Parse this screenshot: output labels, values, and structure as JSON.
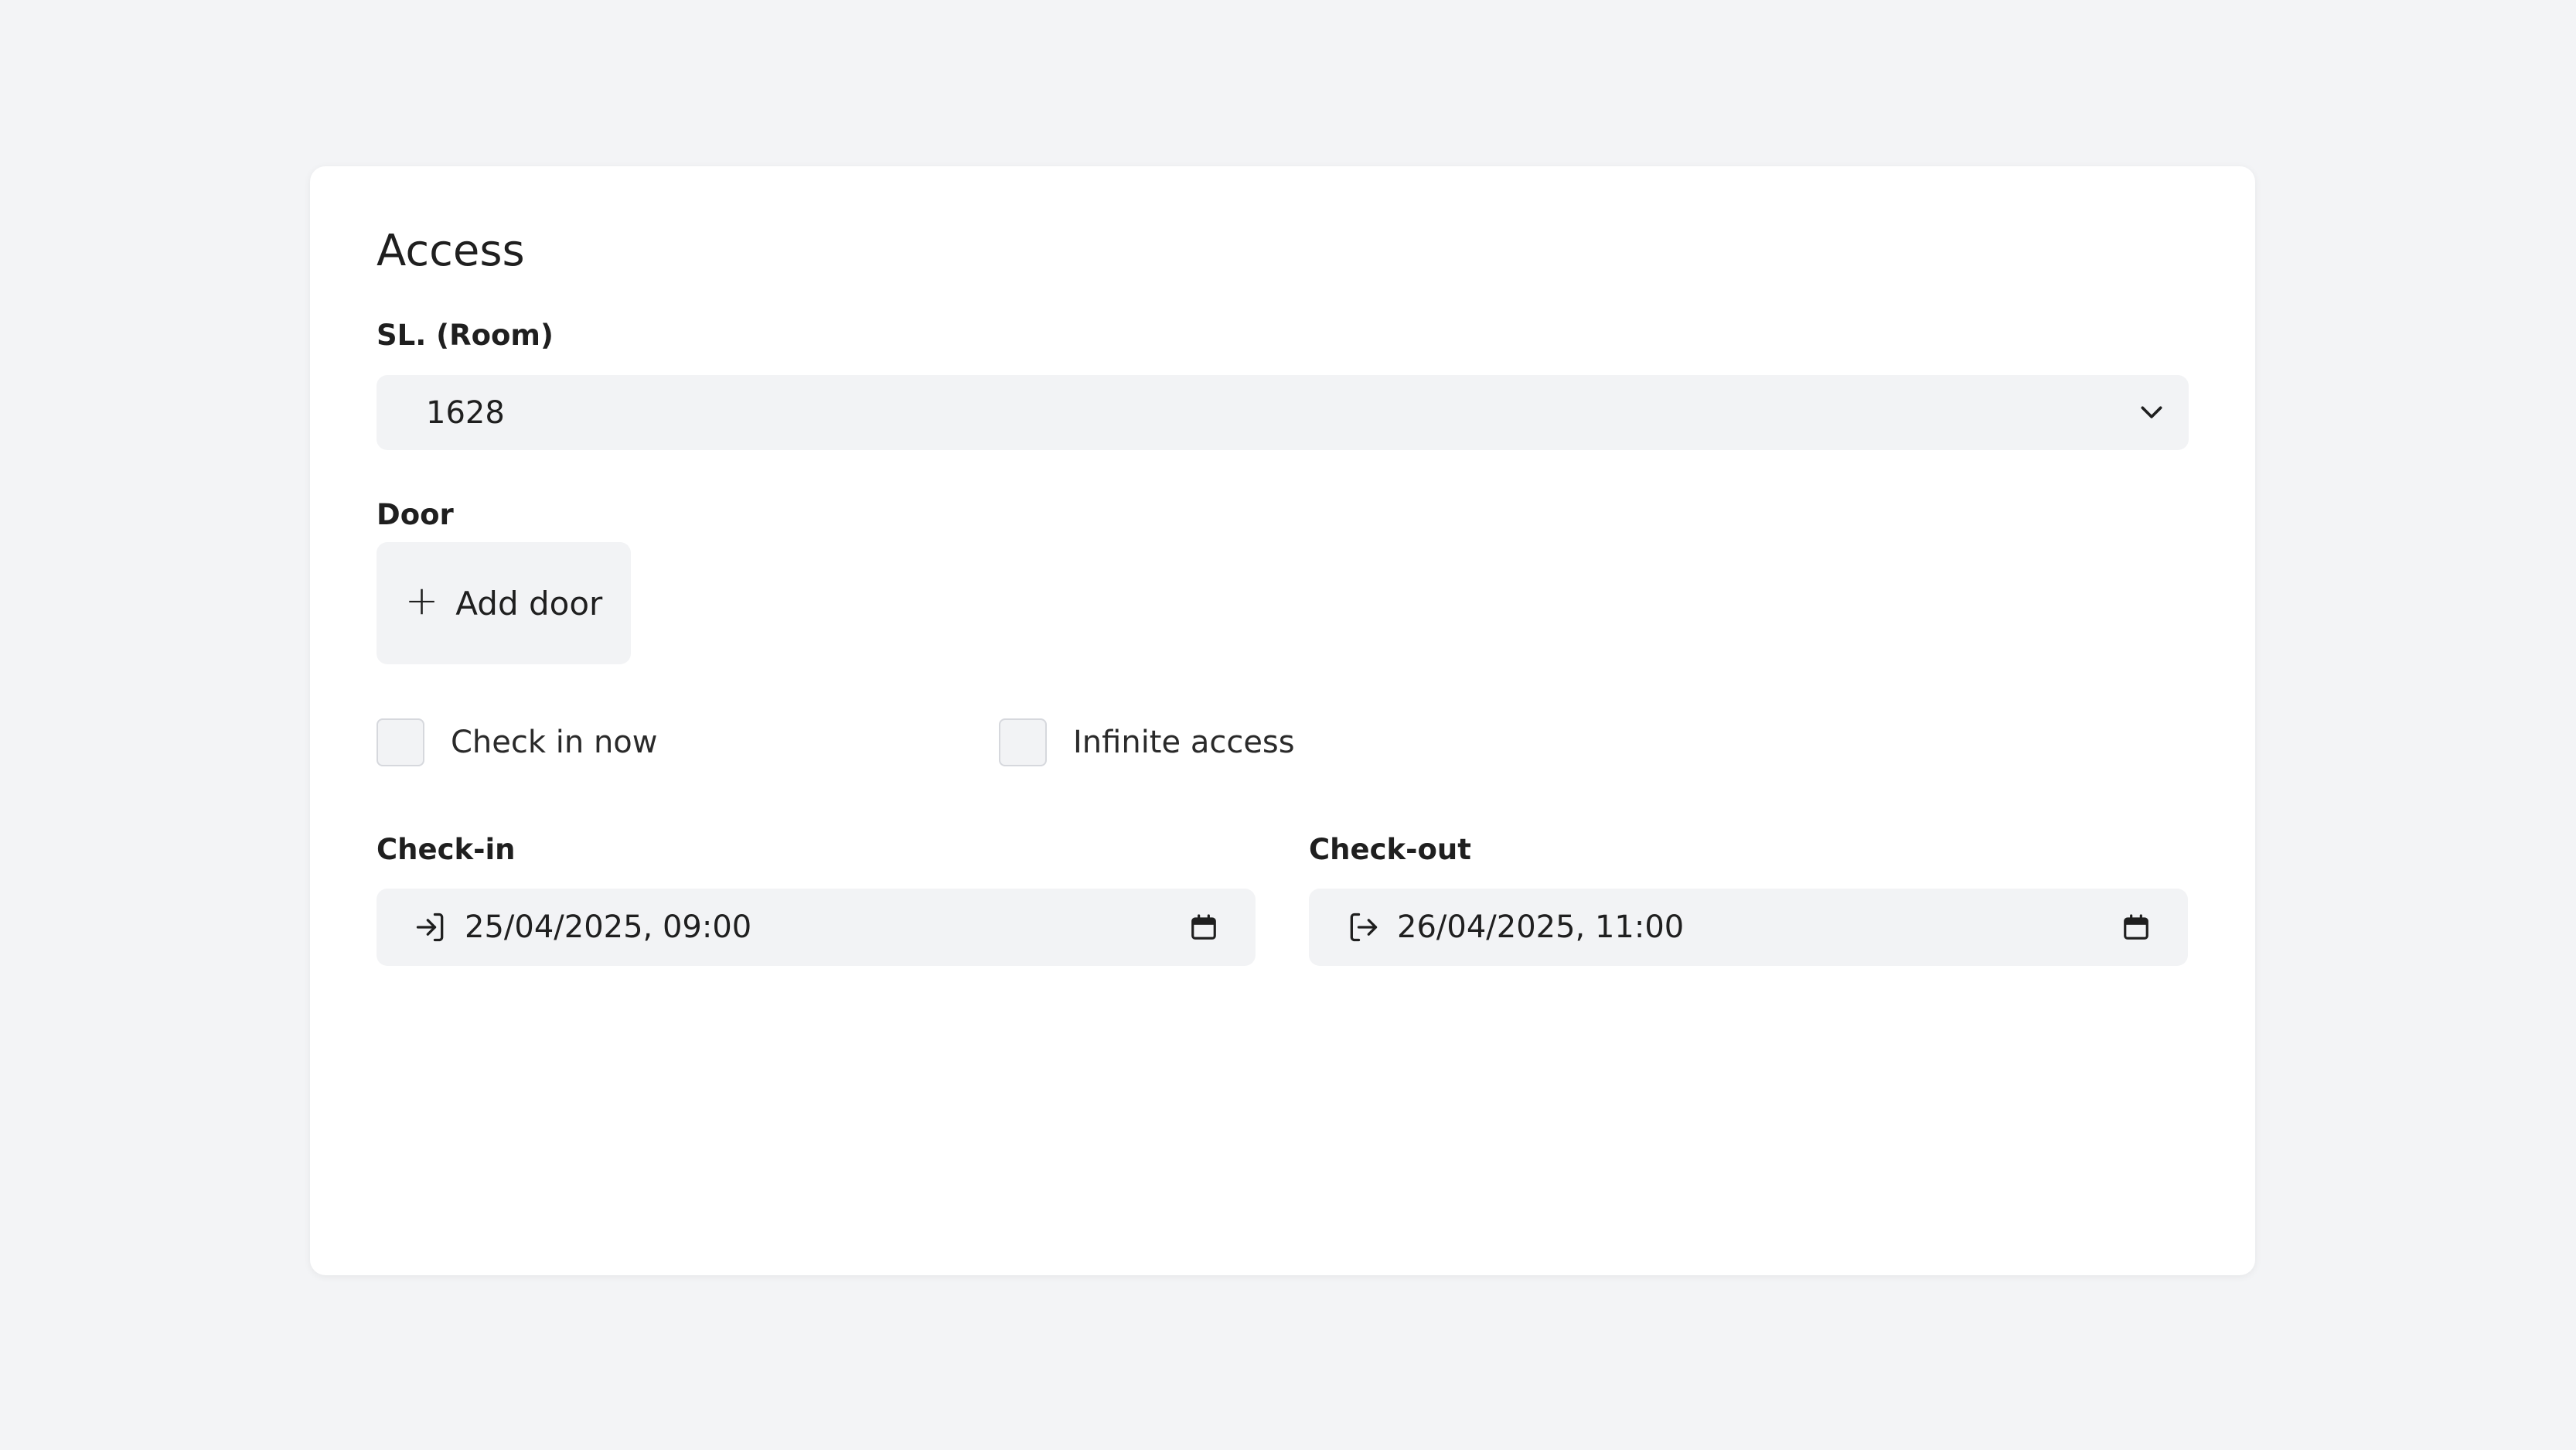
{
  "panel": {
    "title": "Access"
  },
  "room": {
    "label": "SL. (Room)",
    "selected": "1628",
    "icon": "chevron-down-icon"
  },
  "door": {
    "label": "Door",
    "add_button_label": "Add door",
    "add_icon": "plus-icon"
  },
  "options": {
    "check_in_now": {
      "label": "Check in now",
      "checked": false
    },
    "infinite_access": {
      "label": "Infinite access",
      "checked": false
    }
  },
  "check_in": {
    "label": "Check-in",
    "value": "25/04/2025, 09:00",
    "icon": "login-icon",
    "picker_icon": "calendar-icon"
  },
  "check_out": {
    "label": "Check-out",
    "value": "26/04/2025, 11:00",
    "icon": "logout-icon",
    "picker_icon": "calendar-icon"
  },
  "colors": {
    "background": "#f3f4f6",
    "card": "#ffffff",
    "field": "#f2f3f5",
    "text": "#1f1f1f"
  }
}
